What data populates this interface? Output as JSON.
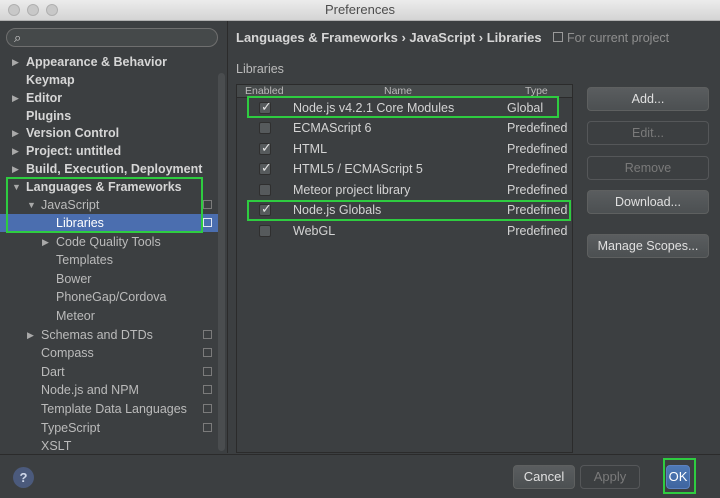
{
  "window": {
    "title": "Preferences"
  },
  "search": {
    "placeholder": ""
  },
  "sidebar": {
    "items": [
      {
        "label": "Appearance & Behavior"
      },
      {
        "label": "Keymap"
      },
      {
        "label": "Editor"
      },
      {
        "label": "Plugins"
      },
      {
        "label": "Version Control"
      },
      {
        "label": "Project: untitled"
      },
      {
        "label": "Build, Execution, Deployment"
      },
      {
        "label": "Languages & Frameworks"
      },
      {
        "label": "JavaScript"
      },
      {
        "label": "Libraries"
      },
      {
        "label": "Code Quality Tools"
      },
      {
        "label": "Templates"
      },
      {
        "label": "Bower"
      },
      {
        "label": "PhoneGap/Cordova"
      },
      {
        "label": "Meteor"
      },
      {
        "label": "Schemas and DTDs"
      },
      {
        "label": "Compass"
      },
      {
        "label": "Dart"
      },
      {
        "label": "Node.js and NPM"
      },
      {
        "label": "Template Data Languages"
      },
      {
        "label": "TypeScript"
      },
      {
        "label": "XSLT"
      }
    ]
  },
  "breadcrumb": {
    "path": "Languages & Frameworks › JavaScript › Libraries",
    "scope": "For current project"
  },
  "libraries": {
    "section_label": "Libraries",
    "columns": {
      "enabled": "Enabled",
      "name": "Name",
      "type": "Type"
    },
    "rows": [
      {
        "enabled": true,
        "name": "Node.js v4.2.1 Core Modules",
        "type": "Global"
      },
      {
        "enabled": false,
        "name": "ECMAScript 6",
        "type": "Predefined"
      },
      {
        "enabled": true,
        "name": "HTML",
        "type": "Predefined"
      },
      {
        "enabled": true,
        "name": "HTML5 / ECMAScript 5",
        "type": "Predefined"
      },
      {
        "enabled": false,
        "name": "Meteor project library",
        "type": "Predefined"
      },
      {
        "enabled": true,
        "name": "Node.js Globals",
        "type": "Predefined"
      },
      {
        "enabled": false,
        "name": "WebGL",
        "type": "Predefined"
      }
    ]
  },
  "actions": {
    "add": "Add...",
    "edit": "Edit...",
    "remove": "Remove",
    "download": "Download...",
    "manage_scopes": "Manage Scopes..."
  },
  "footer": {
    "help": "?",
    "cancel": "Cancel",
    "apply": "Apply",
    "ok": "OK"
  },
  "colors": {
    "highlight": "#2ecc40",
    "selection": "#4b6eaf",
    "background": "#3c3f41"
  }
}
